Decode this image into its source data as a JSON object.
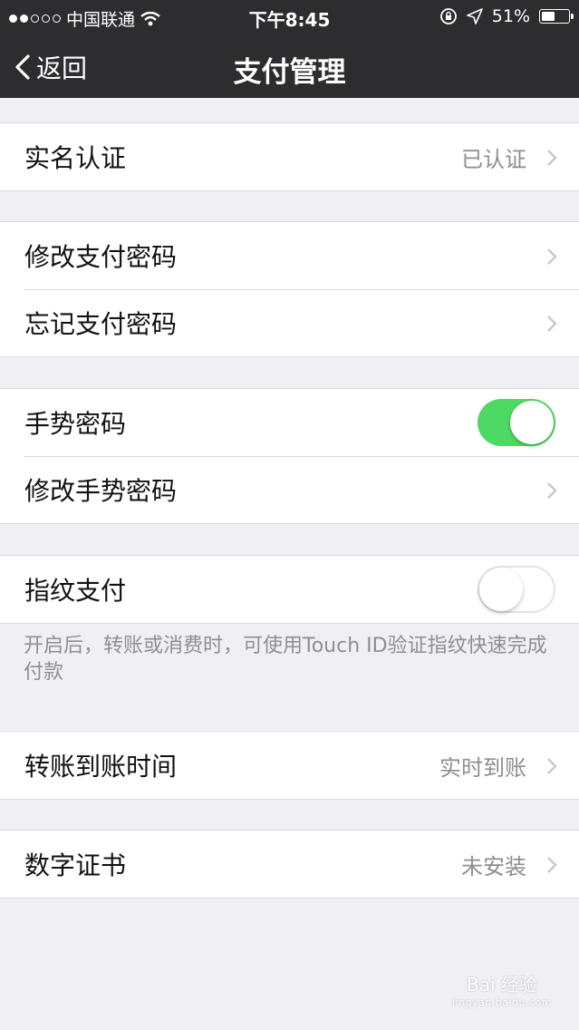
{
  "status_bar": {
    "carrier": "中国联通",
    "time": "下午8:45",
    "battery": "51%",
    "battery_level": 0.51
  },
  "nav": {
    "back_label": "返回",
    "title": "支付管理"
  },
  "sections": [
    {
      "items": [
        {
          "label": "实名认证",
          "value": "已认证"
        }
      ]
    },
    {
      "items": [
        {
          "label": "修改支付密码"
        },
        {
          "label": "忘记支付密码"
        }
      ]
    },
    {
      "items": [
        {
          "label": "手势密码",
          "toggle": true
        },
        {
          "label": "修改手势密码"
        }
      ]
    },
    {
      "items": [
        {
          "label": "指纹支付",
          "toggle": false
        }
      ],
      "note": "开启后，转账或消费时，可使用Touch ID验证指纹快速完成付款"
    },
    {
      "items": [
        {
          "label": "转账到账时间",
          "value": "实时到账"
        }
      ]
    },
    {
      "items": [
        {
          "label": "数字证书",
          "value": "未安装"
        }
      ]
    }
  ],
  "watermark": {
    "text": "Bai 经验",
    "sub": "jingyan.baidu.com"
  },
  "colors": {
    "nav_bg": "#2d2d30",
    "toggle_on": "#4cd964",
    "page_bg": "#efeff4"
  }
}
